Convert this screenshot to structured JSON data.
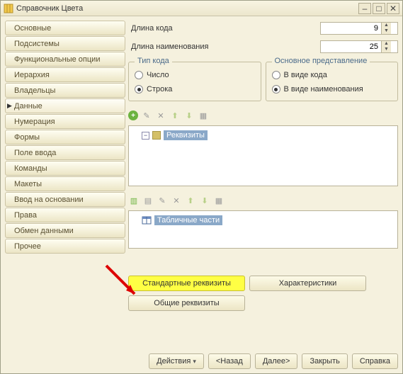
{
  "window": {
    "title": "Справочник Цвета"
  },
  "sidebar": {
    "items": [
      {
        "label": "Основные"
      },
      {
        "label": "Подсистемы"
      },
      {
        "label": "Функциональные опции"
      },
      {
        "label": "Иерархия"
      },
      {
        "label": "Владельцы"
      },
      {
        "label": "Данные"
      },
      {
        "label": "Нумерация"
      },
      {
        "label": "Формы"
      },
      {
        "label": "Поле ввода"
      },
      {
        "label": "Команды"
      },
      {
        "label": "Макеты"
      },
      {
        "label": "Ввод на основании"
      },
      {
        "label": "Права"
      },
      {
        "label": "Обмен данными"
      },
      {
        "label": "Прочее"
      }
    ]
  },
  "fields": {
    "code_length_label": "Длина кода",
    "code_length_value": "9",
    "name_length_label": "Длина наименования",
    "name_length_value": "25"
  },
  "groups": {
    "code_type": {
      "legend": "Тип кода",
      "opts": [
        "Число",
        "Строка"
      ],
      "selected": 1
    },
    "display": {
      "legend": "Основное представление",
      "opts": [
        "В виде кода",
        "В виде наименования"
      ],
      "selected": 1
    }
  },
  "trees": {
    "attrs_label": "Реквизиты",
    "tabs_label": "Табличные части"
  },
  "buttons": {
    "std_attrs": "Стандартные реквизиты",
    "characteristics": "Характеристики",
    "common_attrs": "Общие реквизиты"
  },
  "footer": {
    "actions": "Действия",
    "back": "<Назад",
    "next": "Далее>",
    "close": "Закрыть",
    "help": "Справка"
  }
}
